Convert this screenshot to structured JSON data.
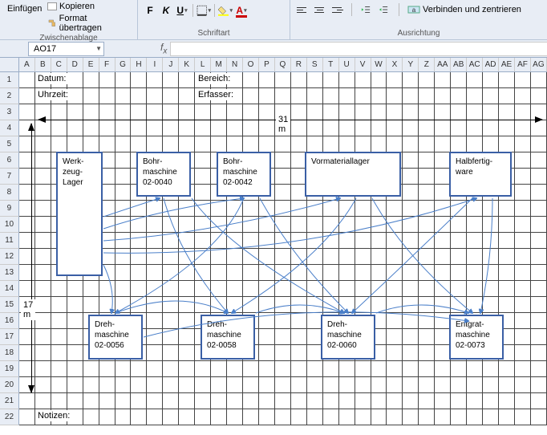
{
  "ribbon": {
    "group1": {
      "paste": "Einfügen",
      "copy": "Kopieren",
      "format_painter": "Format übertragen",
      "label": "Zwischenablage"
    },
    "group2": {
      "bold": "F",
      "italic": "K",
      "underline": "U",
      "label": "Schriftart"
    },
    "group3": {
      "merge": "Verbinden und zentrieren",
      "label": "Ausrichtung"
    }
  },
  "namebox": {
    "value": "AO17"
  },
  "formula": {
    "value": ""
  },
  "columns": [
    "A",
    "B",
    "C",
    "D",
    "E",
    "F",
    "G",
    "H",
    "I",
    "J",
    "K",
    "L",
    "M",
    "N",
    "O",
    "P",
    "Q",
    "R",
    "S",
    "T",
    "U",
    "V",
    "W",
    "X",
    "Y",
    "Z",
    "AA",
    "AB",
    "AC",
    "AD",
    "AE",
    "AF",
    "AG"
  ],
  "rows": [
    "1",
    "2",
    "3",
    "4",
    "5",
    "6",
    "7",
    "8",
    "9",
    "10",
    "11",
    "12",
    "13",
    "14",
    "15",
    "16",
    "17",
    "18",
    "19",
    "20",
    "21",
    "22"
  ],
  "labels": {
    "datum": "Datum:",
    "uhrzeit": "Uhrzeit:",
    "bereich": "Bereich:",
    "erfasser": "Erfasser:",
    "notizen": "Notizen:",
    "dim_h": "31 m",
    "dim_v": "17 m"
  },
  "boxes": {
    "werkzeug": "Werk-\nzeug-\nLager",
    "bohr40": "Bohr-\nmaschine\n02-0040",
    "bohr42": "Bohr-\nmaschine\n02-0042",
    "vormaterial": "Vormateriallager",
    "halbfertig": "Halbfertig-\nware",
    "dreh56": "Dreh-\nmaschine\n02-0056",
    "dreh58": "Dreh-\nmaschine\n02-0058",
    "dreh60": "Dreh-\nmaschine\n02-0060",
    "entgrat": "Entgrat-\nmaschine\n02-0073"
  }
}
